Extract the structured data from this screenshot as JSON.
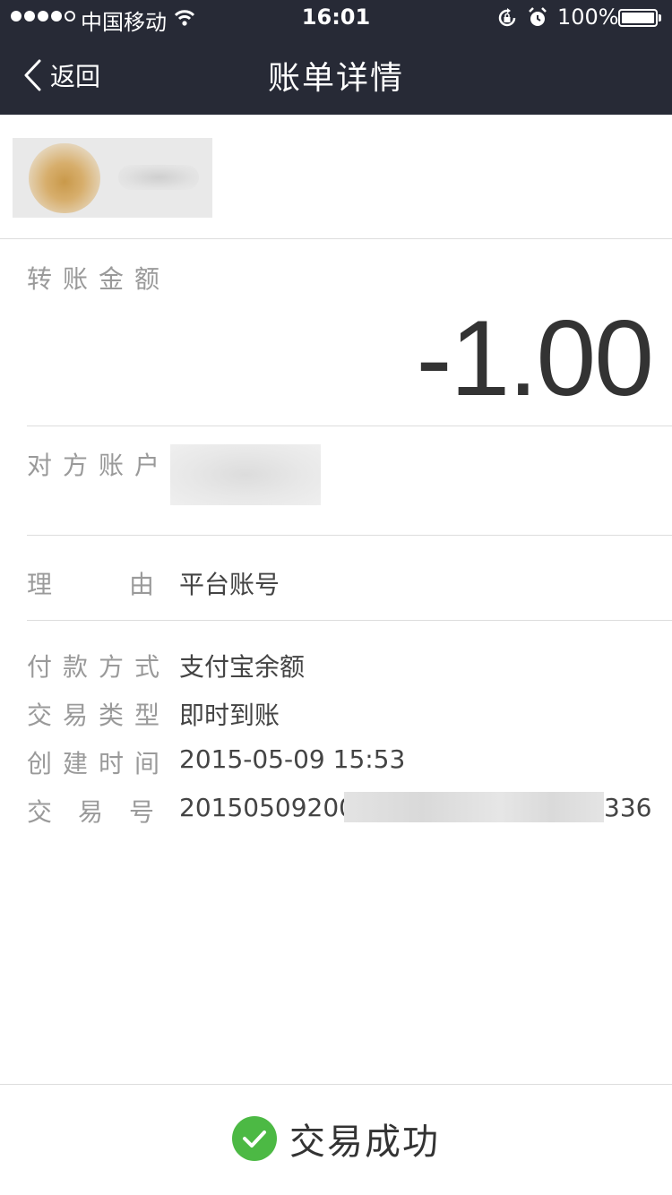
{
  "status_bar": {
    "carrier": "中国移动",
    "time": "16:01",
    "battery": "100%"
  },
  "nav": {
    "back_label": "返回",
    "title": "账单详情"
  },
  "amount": {
    "label": "转账金额",
    "value": "-1.00"
  },
  "counterparty": {
    "label": "对方账户"
  },
  "reason": {
    "label": "理",
    "label2": "由",
    "value": "平台账号"
  },
  "details": {
    "payment_method_label": "付款方式",
    "payment_method": "支付宝余额",
    "type_label": "交易类型",
    "type": "即时到账",
    "created_label": "创建时间",
    "created": "2015-05-09 15:53",
    "txn_label_1": "交",
    "txn_label_2": "易",
    "txn_label_3": "号",
    "txn_prefix": "201505092000",
    "txn_suffix": "336"
  },
  "result": {
    "text": "交易成功",
    "color": "#4cb944"
  },
  "colors": {
    "nav_bg": "#272a36",
    "label": "#9a9a9a"
  }
}
